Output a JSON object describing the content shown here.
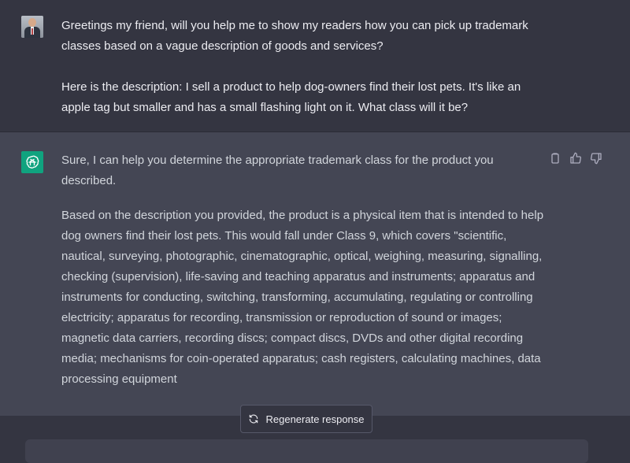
{
  "conversation": {
    "user_message": {
      "paragraphs": [
        "Greetings my friend, will you help me to show my readers how you can pick up trademark classes based on a vague description of goods and services?",
        "Here is the description: I sell a product to help dog-owners find their lost pets. It's like an apple tag but smaller and has a small flashing light on it. What class will it be?"
      ]
    },
    "assistant_message": {
      "paragraphs": [
        "Sure, I can help you determine the appropriate trademark class for the product you described.",
        "Based on the description you provided, the product is a physical item that is intended to help dog owners find their lost pets. This would fall under Class 9, which covers \"scientific, nautical, surveying, photographic, cinematographic, optical, weighing, measuring, signalling, checking (supervision), life-saving and teaching apparatus and instruments; apparatus and instruments for conducting, switching, transforming, accumulating, regulating or controlling electricity; apparatus for recording, transmission or reproduction of sound or images; magnetic data carriers, recording discs; compact discs, DVDs and other digital recording media; mechanisms for coin-operated apparatus; cash registers, calculating machines, data processing equipment"
      ],
      "actions": [
        {
          "name": "copy-icon"
        },
        {
          "name": "thumbs-up-icon"
        },
        {
          "name": "thumbs-down-icon"
        }
      ]
    }
  },
  "controls": {
    "regenerate_label": "Regenerate response",
    "regenerate_icon": "refresh-icon"
  },
  "colors": {
    "background": "#343541",
    "assistant_background": "#444654",
    "accent": "#10a37f"
  }
}
